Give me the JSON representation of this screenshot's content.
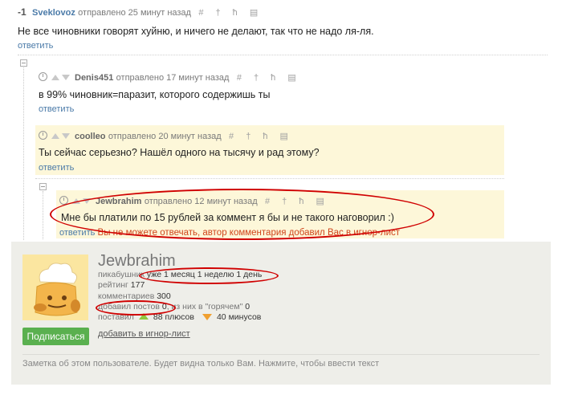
{
  "comments": [
    {
      "score": "-1",
      "author": "Sveklovoz",
      "posted": "отправлено 25 минут назад",
      "text": "Не все чиновники говорят хуйню, и ничего не делают, так что не надо ля-ля.",
      "reply": "ответить"
    },
    {
      "author": "Denis451",
      "posted": "отправлено 17 минут назад",
      "text": "в 99% чиновник=паразит, которого содержишь ты",
      "reply": "ответить"
    },
    {
      "author": "coolleo",
      "posted": "отправлено 20 минут назад",
      "text": "Ты сейчас серьезно? Нашёл одного на тысячу и рад этому?",
      "reply": "ответить"
    },
    {
      "author": "Jewbrahim",
      "posted": "отправлено 12 минут назад",
      "text": "Мне бы платили по 15 рублей за коммент я бы и не такого наговорил :)",
      "reply": "ответить",
      "blocked_notice": "Вы не можете отвечать, автор комментария добавил Вас в игнор-лист"
    }
  ],
  "tools": "# † ħ ▤",
  "profile": {
    "name": "Jewbrahim",
    "member_label": "пикабушник",
    "member_value": "уже 1 месяц 1 неделю 1 день",
    "rating_label": "рейтинг",
    "rating_value": "177",
    "comments_label": "комментариев",
    "comments_value": "300",
    "posts_label": "добавил постов",
    "posts_value": "0",
    "hot_prefix": ", из них в \"горячем\"",
    "hot_value": "0",
    "voted_label": "поставил",
    "pluses": "88 плюсов",
    "minuses": "40 минусов",
    "subscribe": "Подписаться",
    "ignore": "добавить в игнор-лист",
    "note": "Заметка об этом пользователе. Будет видна только Вам. Нажмите, чтобы ввести текст"
  },
  "colors": {
    "accent_link": "#4a7aa8",
    "highlight_bg": "#fdf7d9",
    "annotation": "#d00000",
    "subscribe_bg": "#5ab04f"
  }
}
